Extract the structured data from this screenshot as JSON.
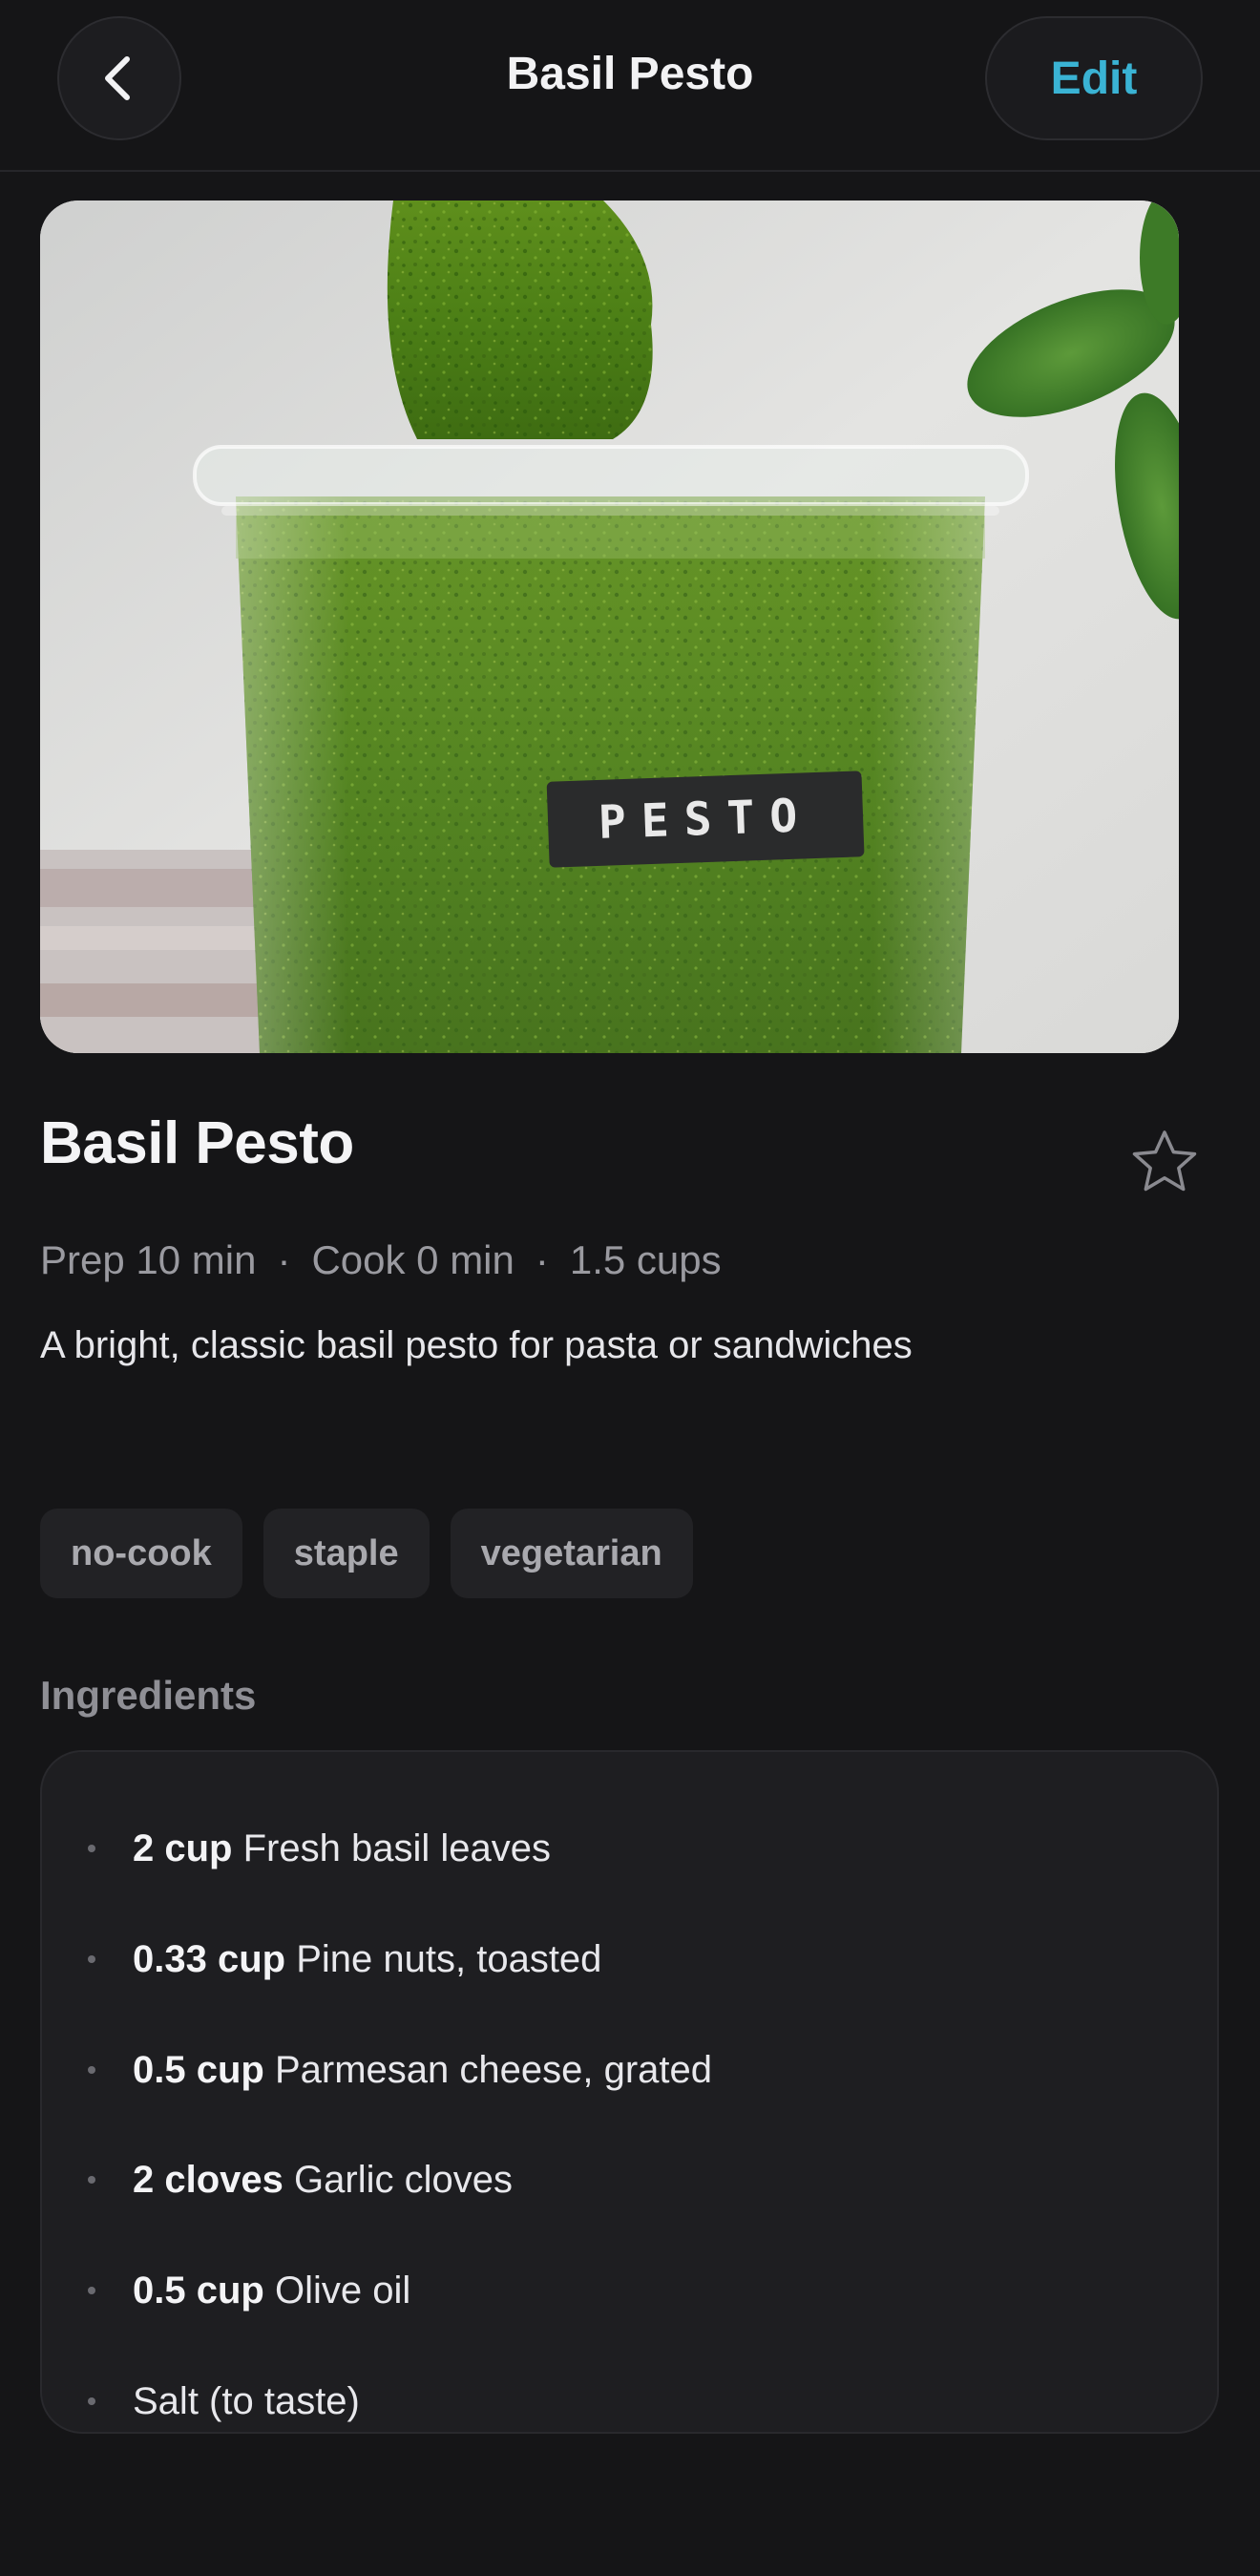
{
  "header": {
    "title": "Basil Pesto",
    "back_icon": "chevron-left-icon",
    "edit_label": "Edit"
  },
  "hero": {
    "jar_label": "PESTO"
  },
  "recipe": {
    "title": "Basil Pesto",
    "favorite_icon": "star-outline-icon",
    "prep": "Prep 10 min",
    "cook": "Cook 0 min",
    "yield": "1.5 cups",
    "separator": "·",
    "description": "A bright, classic basil pesto for pasta or sandwiches"
  },
  "tags": [
    "no-cook",
    "staple",
    "vegetarian"
  ],
  "ingredients": {
    "label": "Ingredients",
    "items": [
      {
        "qty": "2 cup",
        "name": "Fresh basil leaves"
      },
      {
        "qty": "0.33 cup",
        "name": "Pine nuts, toasted"
      },
      {
        "qty": "0.5 cup",
        "name": "Parmesan cheese, grated"
      },
      {
        "qty": "2 cloves",
        "name": "Garlic cloves"
      },
      {
        "qty": "0.5 cup",
        "name": "Olive oil"
      },
      {
        "qty": "",
        "name": "Salt (to taste)"
      }
    ]
  },
  "colors": {
    "background": "#151517",
    "accent": "#3ab3d4",
    "card": "#1e1e21",
    "muted_text": "#9a9aa0"
  }
}
